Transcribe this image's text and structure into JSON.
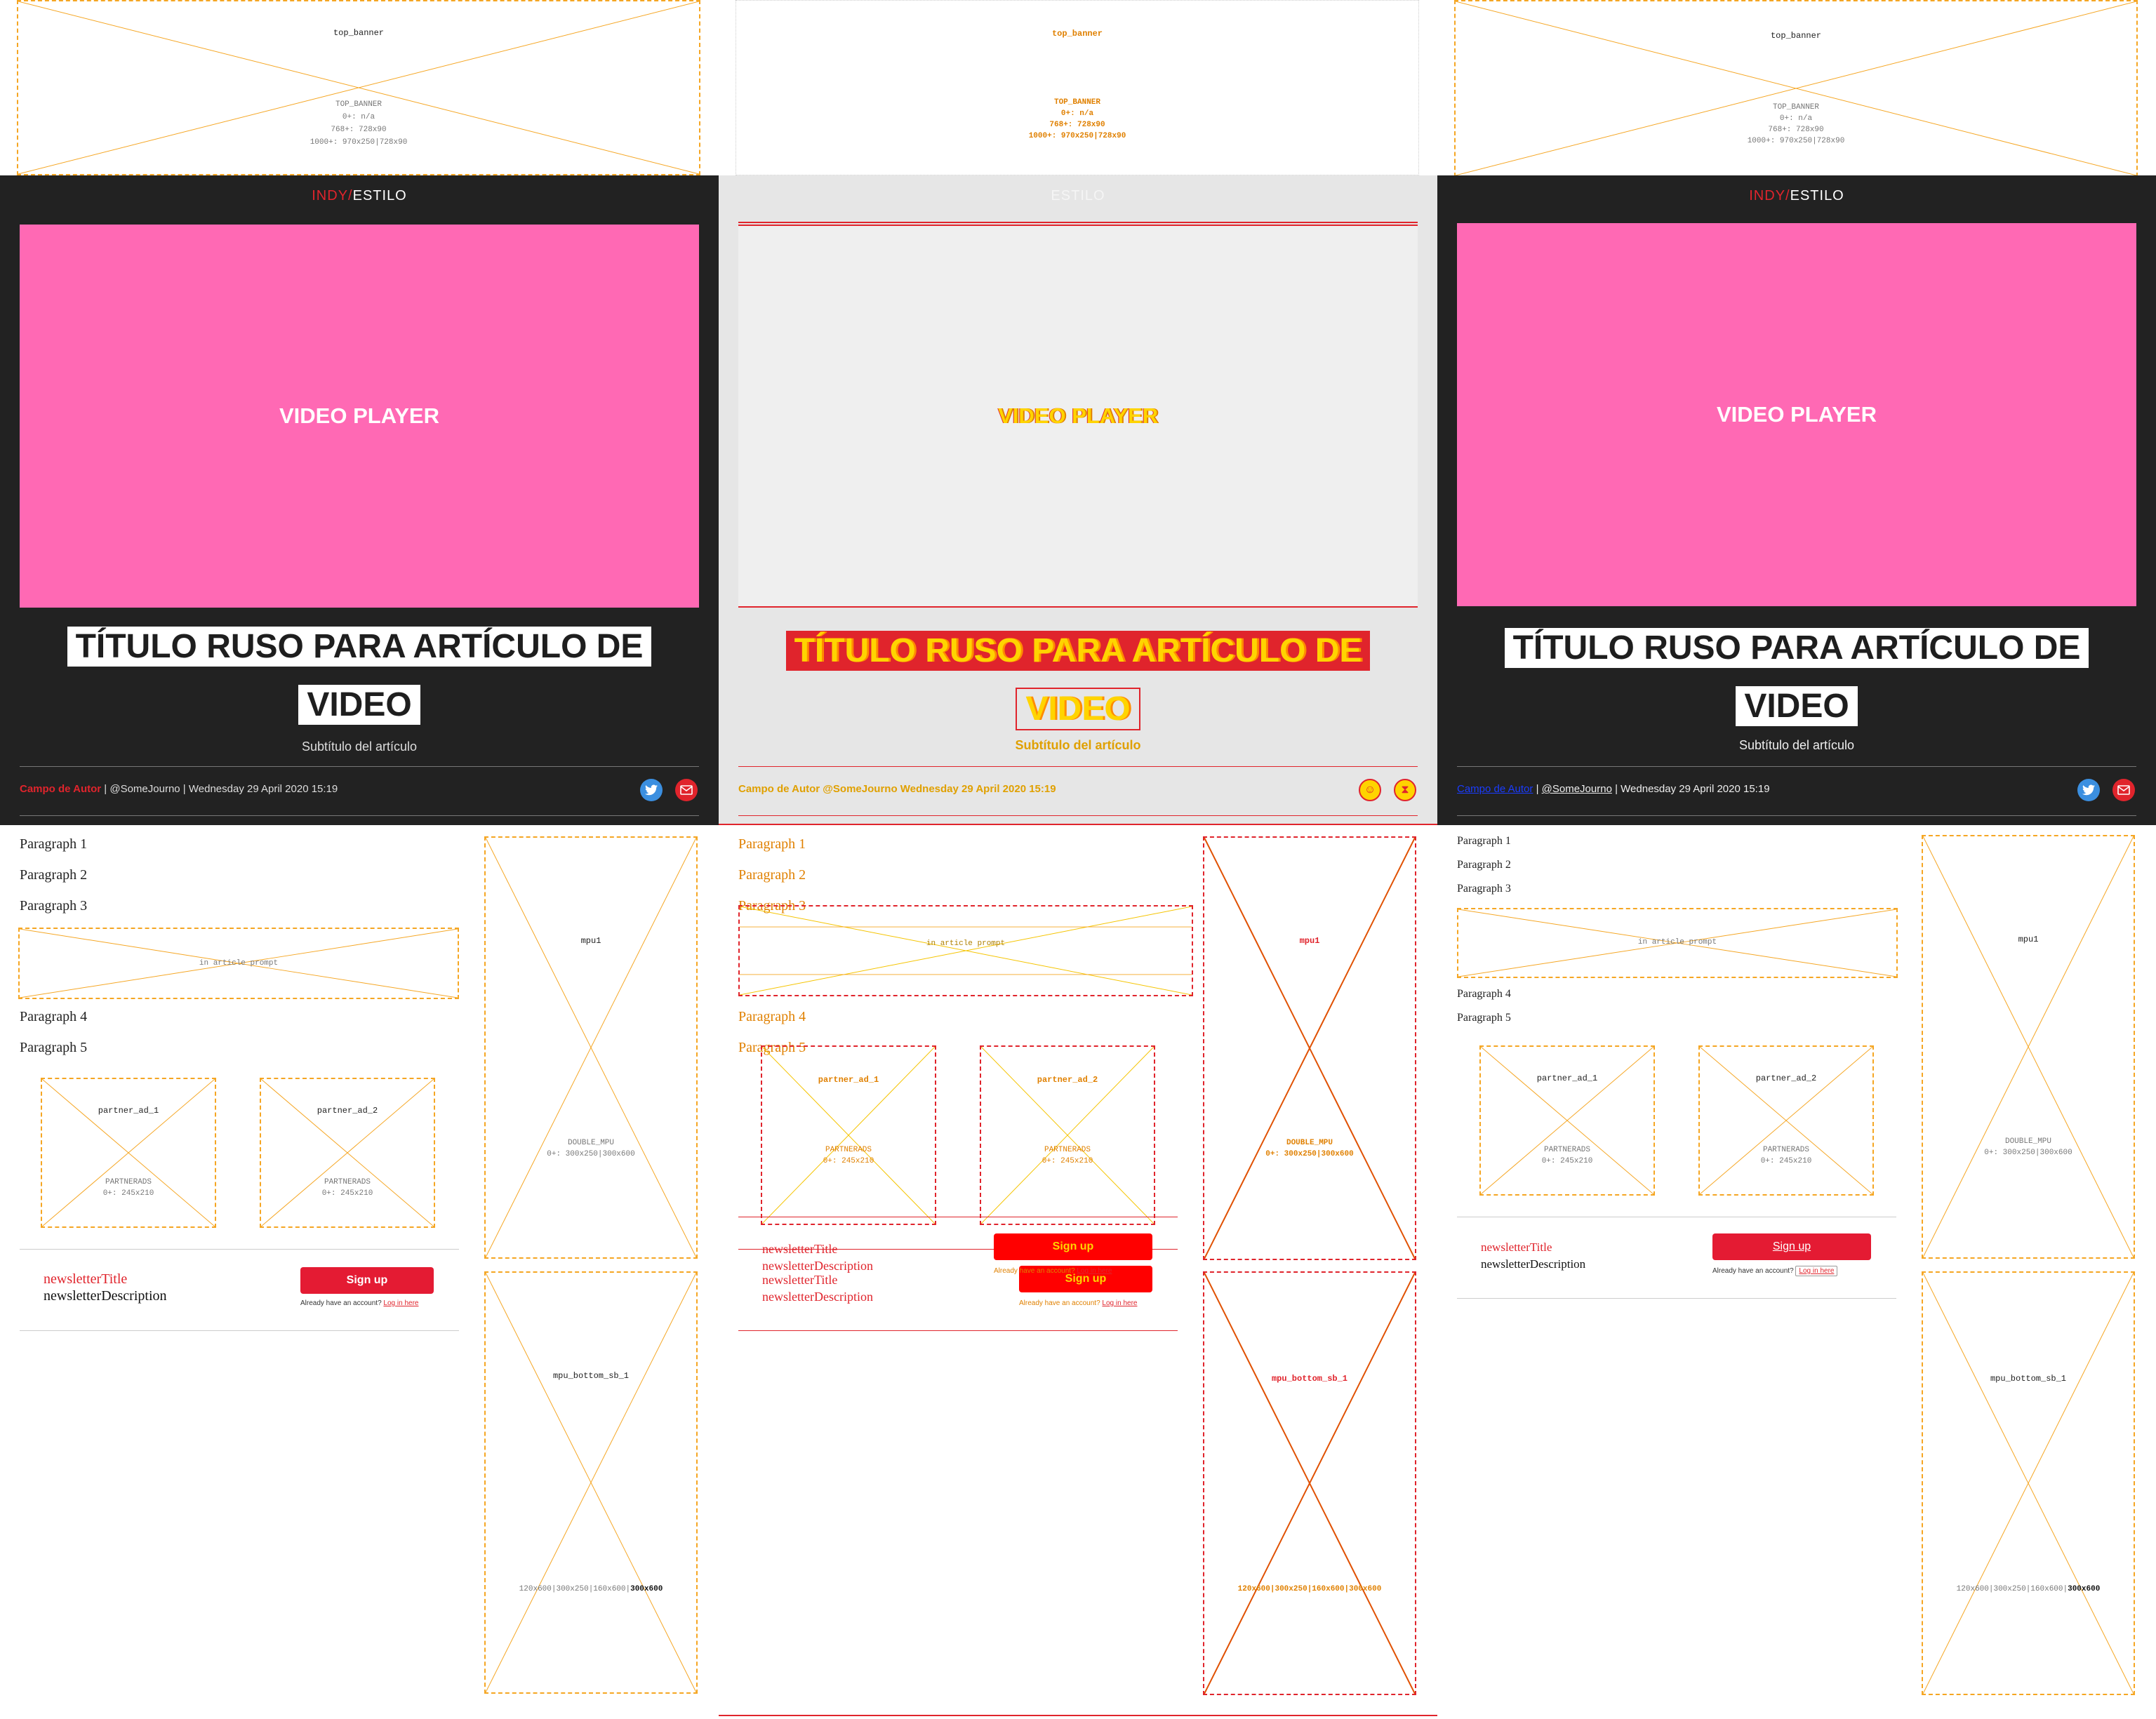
{
  "top_banner": {
    "name": "top_banner",
    "code": "TOP_BANNER",
    "sizes": [
      "0+: n/a",
      "768+: 728x90",
      "1000+: 970x250|728x90"
    ]
  },
  "header": {
    "brand_indy": "INDY",
    "brand_slash": "/",
    "brand_section": "ESTILO"
  },
  "video": {
    "label": "VIDEO PLAYER"
  },
  "article": {
    "title_line1": "TÍTULO RUSO PARA ARTÍCULO DE",
    "title_line2": "VIDEO",
    "subtitle": "Subtítulo del artículo",
    "author": "Campo de Autor",
    "handle": "@SomeJourno",
    "date": "Wednesday 29 April 2020 15:19",
    "separator": " | "
  },
  "share": {
    "twitter_icon": "twitter-icon",
    "email_icon": "email-icon"
  },
  "paragraphs": [
    "Paragraph 1",
    "Paragraph 2",
    "Paragraph 3",
    "Paragraph 4",
    "Paragraph 5"
  ],
  "in_article_prompt": {
    "label": "in article prompt"
  },
  "partner_ads": [
    {
      "name": "partner_ad_1",
      "code": "PARTNERADS",
      "size": "0+: 245x210"
    },
    {
      "name": "partner_ad_2",
      "code": "PARTNERADS",
      "size": "0+: 245x210"
    }
  ],
  "newsletter": {
    "title": "newsletterTitle",
    "description": "newsletterDescription",
    "signup_label": "Sign up",
    "already_text": "Already have an account?",
    "login_label": "Log in here"
  },
  "mpu1": {
    "name": "mpu1",
    "code": "DOUBLE_MPU",
    "size": "0+: 300x250|300x600"
  },
  "mpu_bottom": {
    "name": "mpu_bottom_sb_1",
    "sizes": "120x600|300x250|160x600|",
    "size_bold": "300x600"
  },
  "colors": {
    "accent": "#e0242c",
    "video_bg": "#ff69b4",
    "dark_bg": "#222222",
    "ad_border": "#f5a623",
    "twitter": "#3b8fe0"
  }
}
